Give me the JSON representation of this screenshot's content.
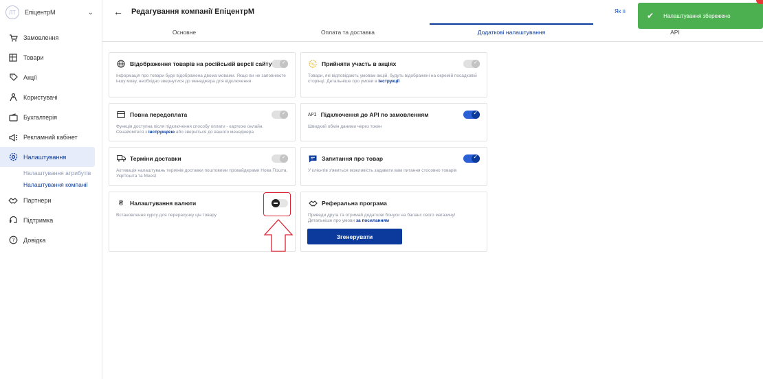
{
  "sidebar": {
    "avatar_initials": "ЛТ",
    "company": "ЕпіцентрМ",
    "items": [
      {
        "label": "Замовлення",
        "icon": "cart-icon"
      },
      {
        "label": "Товари",
        "icon": "products-icon"
      },
      {
        "label": "Акції",
        "icon": "discount-icon"
      },
      {
        "label": "Користувачі",
        "icon": "users-icon"
      },
      {
        "label": "Бухгалтерія",
        "icon": "wallet-icon"
      },
      {
        "label": "Рекламний кабінет",
        "icon": "megaphone-icon"
      },
      {
        "label": "Налаштування",
        "icon": "gear-icon",
        "active": true
      },
      {
        "label": "Партнери",
        "icon": "handshake-icon"
      },
      {
        "label": "Підтримка",
        "icon": "support-icon"
      },
      {
        "label": "Довідка",
        "icon": "help-icon"
      }
    ],
    "sub_items": [
      {
        "label": "Налаштування атрибутів"
      },
      {
        "label": "Налаштування компанії",
        "active": true
      }
    ]
  },
  "header": {
    "title": "Редагування компанії ЕпіцентрМ",
    "help_link": "Як п"
  },
  "tabs": [
    "Основне",
    "Оплата та доставка",
    "Додаткові налаштування",
    "API"
  ],
  "cards": {
    "ru_version": {
      "title": "Відображення товарів на російській версії сайту",
      "desc": "Інформація про товари буде відображена двома мовами. Якщо ви не заповнюєте іншу мову, необхідно звернутися до менеджера для відключення"
    },
    "promos": {
      "title": "Прийняти участь в акціях",
      "desc_pre": "Товари, які відповідають умовам акцій, будуть відображені на окремій посадковій сторінці. Детальніше про умови в ",
      "desc_link": "інструкції"
    },
    "prepay": {
      "title": "Повна передоплата",
      "desc_pre": "Функція доступна після підключення способу оплати - карткою онлайн. Ознайомтеся з ",
      "desc_link": "інструкцією",
      "desc_post": " або зверніться до вашого менеджера"
    },
    "api": {
      "icon_text": "API",
      "title": "Підключення до API по замовленням",
      "desc": "Швидкий обмін даними через токен"
    },
    "delivery": {
      "title": "Терміни доставки",
      "desc": "Активація налаштувань термінів доставки поштовими провайдерами Нова Пошта, УкрПошта та Meest"
    },
    "questions": {
      "title": "Запитання про товар",
      "desc": "У клієнтів з'явиться можливість задавати вам питання стосовно товарів"
    },
    "currency": {
      "title": "Налаштування валюти",
      "desc": "Встановлення курсу для перерахунку цін товару"
    },
    "referral": {
      "title": "Реферальна програма",
      "desc_pre": "Приведи друга та отримай додаткові бонуси на баланс свого магазину! Детальніше про умови ",
      "desc_link": "за посиланням",
      "button": "Згенерувати"
    }
  },
  "toast": {
    "message": "Налаштування збережено"
  },
  "colors": {
    "primary": "#0b3a9c",
    "success": "#4caf50",
    "highlight": "#dd2233"
  }
}
